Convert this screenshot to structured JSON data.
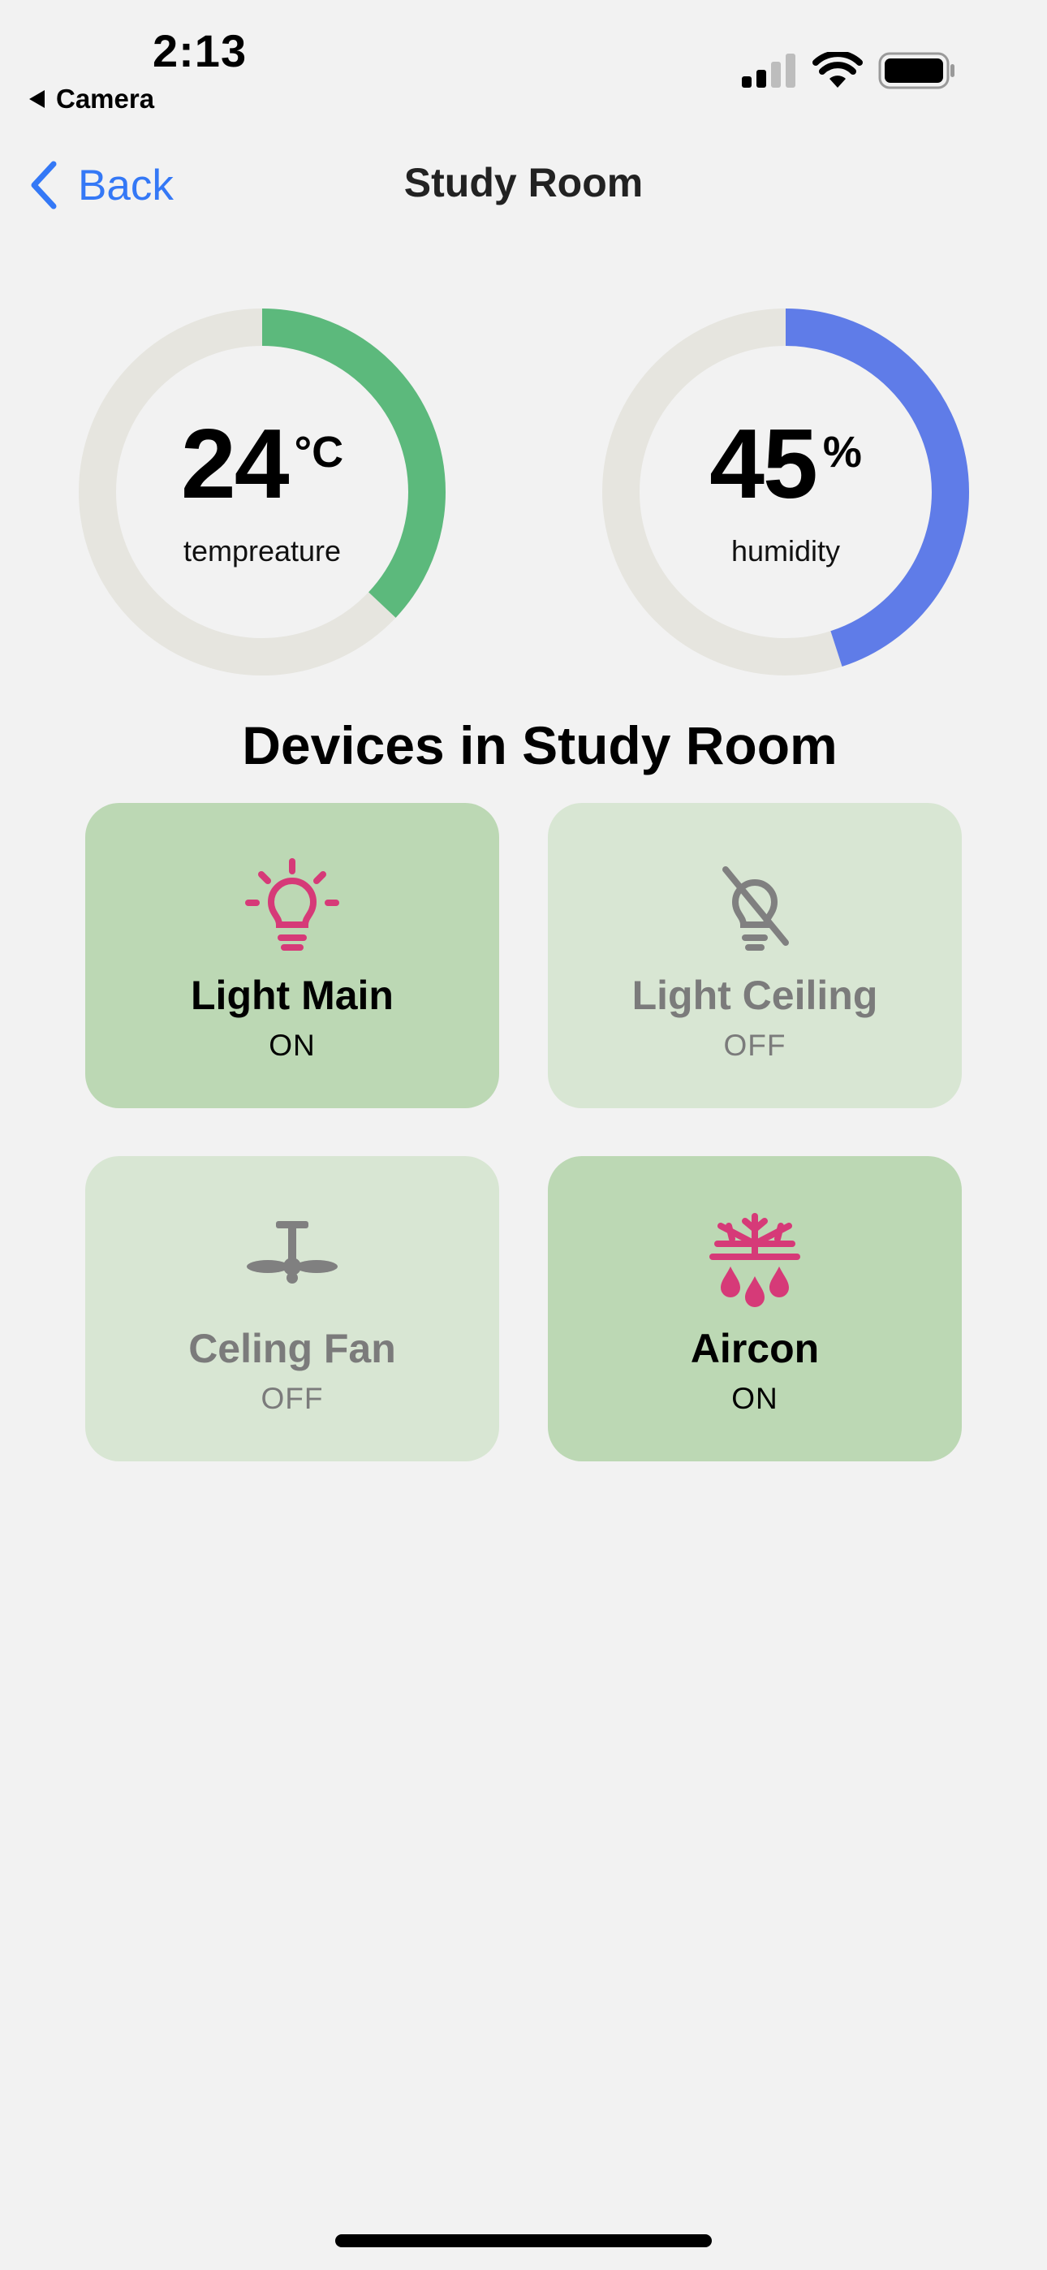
{
  "status_bar": {
    "time": "2:13",
    "back_app": "Camera",
    "signal_icon": "cellular-signal-icon",
    "wifi_icon": "wifi-icon",
    "battery_icon": "battery-icon"
  },
  "nav": {
    "back_label": "Back",
    "title": "Study Room"
  },
  "climate": {
    "temperature": {
      "value": "24",
      "unit": "°C",
      "label": "tempreature",
      "fill_fraction": 0.37,
      "color": "#5cb97c"
    },
    "humidity": {
      "value": "45",
      "unit": "%",
      "label": "humidity",
      "fill_fraction": 0.45,
      "color": "#5f7ce8"
    },
    "track_color": "#e6e5df"
  },
  "section": {
    "title": "Devices in Study Room"
  },
  "devices": [
    {
      "name": "Light Main",
      "state": "ON",
      "icon": "lightbulb-on-icon"
    },
    {
      "name": "Light Ceiling",
      "state": "OFF",
      "icon": "lightbulb-off-icon"
    },
    {
      "name": "Celing Fan",
      "state": "OFF",
      "icon": "ceiling-fan-icon"
    },
    {
      "name": "Aircon",
      "state": "ON",
      "icon": "aircon-icon"
    }
  ],
  "colors": {
    "accent_blue": "#3478f6",
    "icon_on": "#d63a78",
    "icon_off": "#808080",
    "card_on": "#bcd8b4",
    "card_off": "#d8e6d3"
  }
}
